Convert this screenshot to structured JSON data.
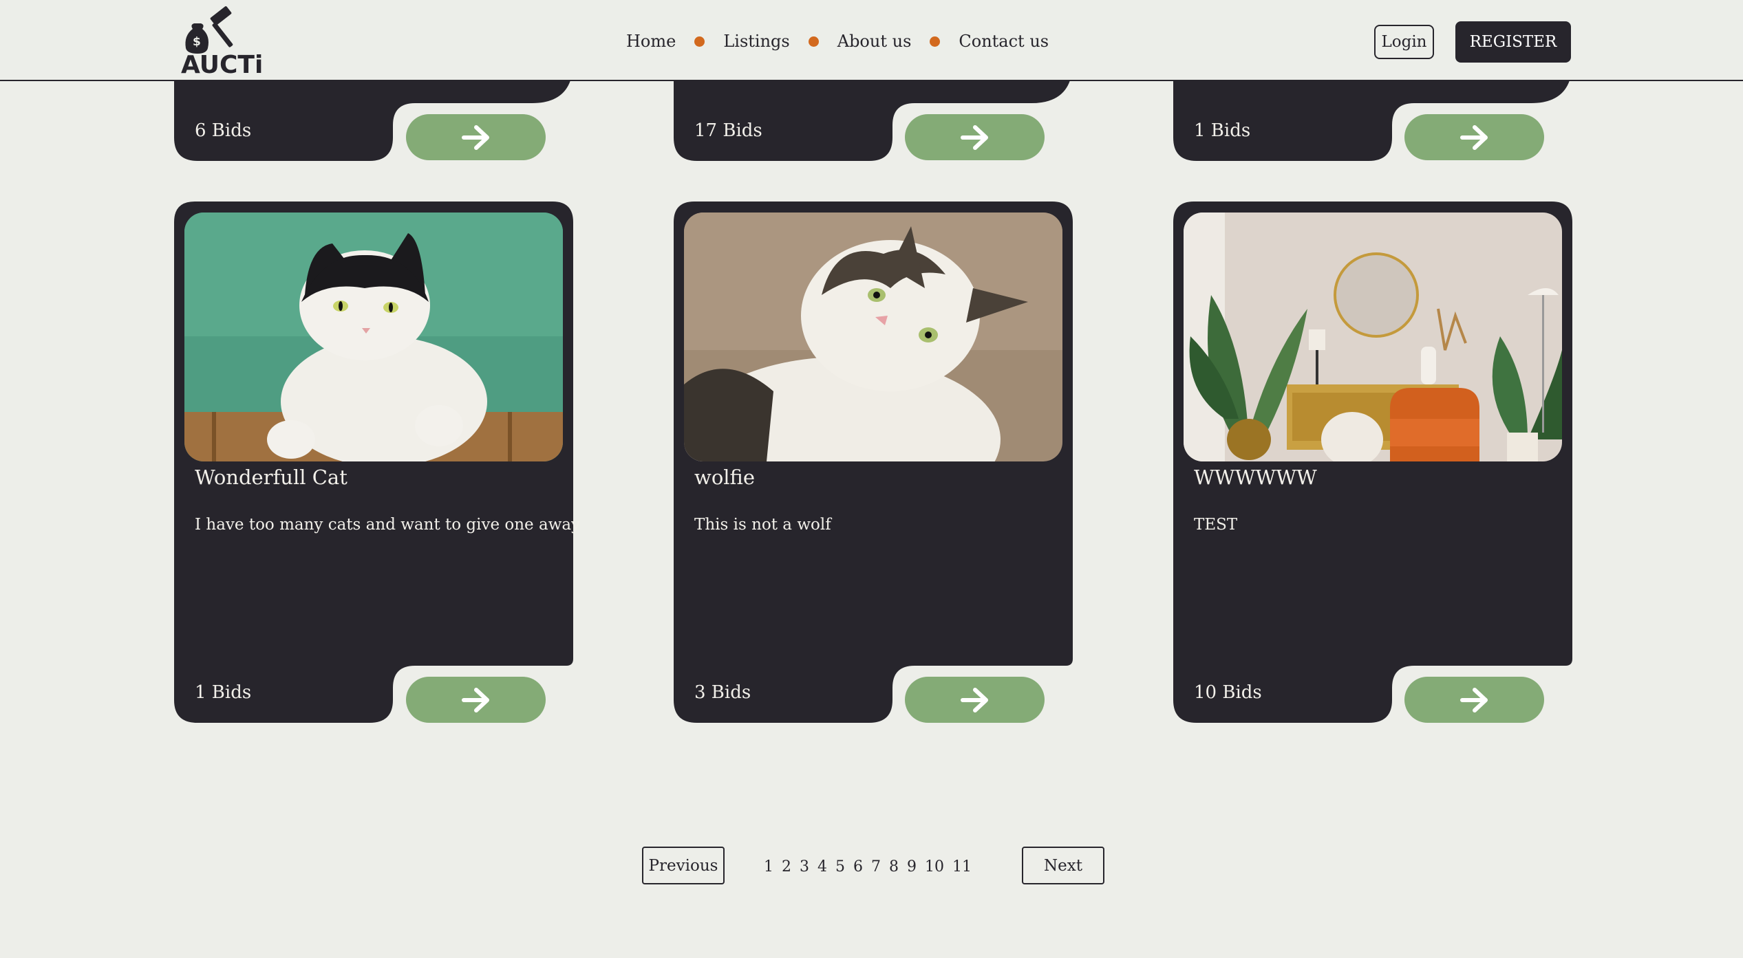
{
  "header": {
    "logo_text": "AUCTi",
    "nav": [
      "Home",
      "Listings",
      "About us",
      "Contact us"
    ],
    "login_label": "Login",
    "register_label": "REGISTER"
  },
  "top_row": [
    {
      "bids": "6 Bids"
    },
    {
      "bids": "17 Bids"
    },
    {
      "bids": "1 Bids"
    }
  ],
  "cards": [
    {
      "title": "Wonderfull Cat",
      "description": "I have too many cats and want to give one away",
      "bids": "1 Bids",
      "image": "black-and-white-cat-photo"
    },
    {
      "title": "wolfie",
      "description": "This is not a wolf",
      "bids": "3 Bids",
      "image": "tabby-cat-looking-up-photo"
    },
    {
      "title": "WWWWWW",
      "description": "TEST",
      "bids": "10 Bids",
      "image": "living-room-interior-photo"
    }
  ],
  "pagination": {
    "previous_label": "Previous",
    "next_label": "Next",
    "pages": [
      "1",
      "2",
      "3",
      "4",
      "5",
      "6",
      "7",
      "8",
      "9",
      "10",
      "11"
    ]
  },
  "colors": {
    "background": "#edeee9",
    "card": "#27252c",
    "accent_green": "#84ab76",
    "nav_dot": "#d2691e"
  },
  "icons": [
    "gavel-logo-icon",
    "arrow-right-icon"
  ]
}
